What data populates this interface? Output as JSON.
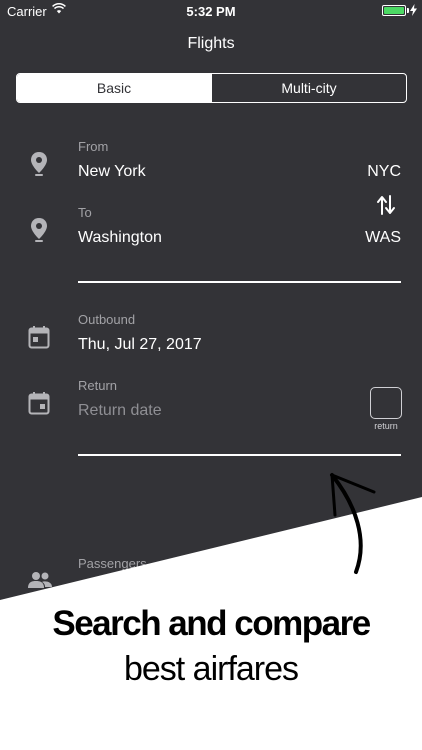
{
  "status_bar": {
    "carrier": "Carrier",
    "time": "5:32 PM",
    "battery_level": 1.0
  },
  "nav": {
    "title": "Flights"
  },
  "tabs": [
    {
      "label": "Basic",
      "active": true
    },
    {
      "label": "Multi-city",
      "active": false
    }
  ],
  "form": {
    "from": {
      "label": "From",
      "value": "New York",
      "code": "NYC"
    },
    "to": {
      "label": "To",
      "value": "Washington",
      "code": "WAS"
    },
    "outbound": {
      "label": "Outbound",
      "value": "Thu, Jul 27, 2017"
    },
    "return": {
      "label": "Return",
      "placeholder": "Return date",
      "toggle_label": "return"
    },
    "passengers": {
      "label": "Passengers"
    }
  },
  "promo": {
    "title": "Search and compare",
    "subtitle": "best airfares"
  },
  "icons": {
    "from": "location-pin-icon",
    "to": "location-pin-icon",
    "swap": "swap-arrows-icon",
    "outbound": "calendar-icon",
    "return": "calendar-plus-icon",
    "passengers": "people-icon"
  },
  "colors": {
    "background": "#333337",
    "text": "#ffffff",
    "label": "#a2a2a6",
    "battery": "#4cd964",
    "promo": "#ffffff"
  }
}
